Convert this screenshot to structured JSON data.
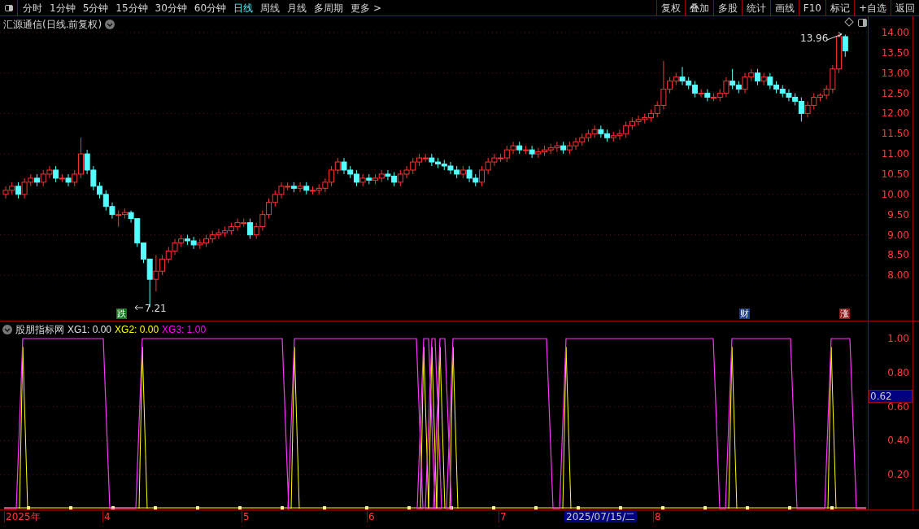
{
  "toolbar": {
    "period_tabs": [
      {
        "label": "分时",
        "selected": false
      },
      {
        "label": "1分钟",
        "selected": false
      },
      {
        "label": "5分钟",
        "selected": false
      },
      {
        "label": "15分钟",
        "selected": false
      },
      {
        "label": "30分钟",
        "selected": false
      },
      {
        "label": "60分钟",
        "selected": false
      },
      {
        "label": "日线",
        "selected": true
      },
      {
        "label": "周线",
        "selected": false
      },
      {
        "label": "月线",
        "selected": false
      },
      {
        "label": "多周期",
        "selected": false
      }
    ],
    "more": "更多 >",
    "actions": [
      "复权",
      "叠加",
      "多股",
      "统计",
      "画线",
      "F10",
      "标记",
      "+自选",
      "返回"
    ]
  },
  "chart_title": "汇源通信(日线.前复权)",
  "chart_data": {
    "type": "candlestick",
    "ohlc": [
      [
        10.0,
        10.2,
        9.9,
        10.1
      ],
      [
        10.1,
        10.3,
        10.0,
        10.2
      ],
      [
        10.2,
        10.3,
        9.9,
        10.0
      ],
      [
        10.0,
        10.4,
        9.9,
        10.3
      ],
      [
        10.3,
        10.5,
        10.2,
        10.4
      ],
      [
        10.4,
        10.5,
        10.2,
        10.3
      ],
      [
        10.3,
        10.6,
        10.2,
        10.5
      ],
      [
        10.5,
        10.7,
        10.4,
        10.6
      ],
      [
        10.6,
        10.7,
        10.3,
        10.4
      ],
      [
        10.4,
        10.5,
        10.3,
        10.4
      ],
      [
        10.4,
        10.5,
        10.2,
        10.3
      ],
      [
        10.3,
        10.6,
        10.2,
        10.5
      ],
      [
        10.5,
        11.4,
        10.4,
        11.0
      ],
      [
        11.0,
        11.1,
        10.5,
        10.6
      ],
      [
        10.6,
        10.7,
        10.1,
        10.2
      ],
      [
        10.2,
        10.3,
        9.9,
        10.0
      ],
      [
        10.0,
        10.1,
        9.6,
        9.7
      ],
      [
        9.7,
        9.8,
        9.4,
        9.5
      ],
      [
        9.5,
        9.6,
        9.2,
        9.5
      ],
      [
        9.5,
        9.65,
        9.4,
        9.55
      ],
      [
        9.55,
        9.6,
        9.3,
        9.4
      ],
      [
        9.4,
        9.4,
        8.7,
        8.8
      ],
      [
        8.8,
        8.8,
        8.3,
        8.4
      ],
      [
        8.4,
        8.4,
        7.21,
        7.9
      ],
      [
        7.9,
        8.5,
        7.6,
        8.1
      ],
      [
        8.1,
        8.5,
        8.0,
        8.4
      ],
      [
        8.4,
        8.7,
        8.3,
        8.6
      ],
      [
        8.6,
        8.9,
        8.5,
        8.8
      ],
      [
        8.8,
        9.0,
        8.7,
        8.9
      ],
      [
        8.9,
        9.0,
        8.75,
        8.85
      ],
      [
        8.85,
        8.95,
        8.65,
        8.75
      ],
      [
        8.75,
        8.9,
        8.65,
        8.8
      ],
      [
        8.8,
        9.0,
        8.7,
        8.9
      ],
      [
        8.9,
        9.1,
        8.8,
        9.0
      ],
      [
        9.0,
        9.15,
        8.9,
        9.05
      ],
      [
        9.05,
        9.2,
        8.95,
        9.1
      ],
      [
        9.1,
        9.3,
        9.0,
        9.2
      ],
      [
        9.2,
        9.4,
        9.1,
        9.3
      ],
      [
        9.3,
        9.4,
        9.2,
        9.3
      ],
      [
        9.3,
        9.4,
        8.9,
        9.0
      ],
      [
        9.0,
        9.3,
        8.9,
        9.2
      ],
      [
        9.2,
        9.6,
        9.1,
        9.5
      ],
      [
        9.5,
        9.9,
        9.4,
        9.8
      ],
      [
        9.8,
        10.1,
        9.7,
        10.0
      ],
      [
        10.0,
        10.3,
        9.9,
        10.2
      ],
      [
        10.2,
        10.3,
        10.1,
        10.2
      ],
      [
        10.2,
        10.3,
        10.05,
        10.15
      ],
      [
        10.15,
        10.3,
        10.05,
        10.2
      ],
      [
        10.2,
        10.3,
        10.0,
        10.1
      ],
      [
        10.1,
        10.2,
        10.0,
        10.1
      ],
      [
        10.1,
        10.25,
        10.0,
        10.15
      ],
      [
        10.15,
        10.4,
        10.05,
        10.3
      ],
      [
        10.3,
        10.7,
        10.2,
        10.6
      ],
      [
        10.6,
        10.9,
        10.5,
        10.8
      ],
      [
        10.8,
        10.9,
        10.5,
        10.6
      ],
      [
        10.6,
        10.7,
        10.4,
        10.5
      ],
      [
        10.5,
        10.6,
        10.2,
        10.3
      ],
      [
        10.3,
        10.5,
        10.2,
        10.4
      ],
      [
        10.4,
        10.5,
        10.25,
        10.35
      ],
      [
        10.35,
        10.5,
        10.25,
        10.4
      ],
      [
        10.4,
        10.6,
        10.3,
        10.5
      ],
      [
        10.5,
        10.6,
        10.35,
        10.45
      ],
      [
        10.45,
        10.55,
        10.2,
        10.3
      ],
      [
        10.3,
        10.6,
        10.2,
        10.5
      ],
      [
        10.5,
        10.7,
        10.4,
        10.6
      ],
      [
        10.6,
        10.9,
        10.5,
        10.8
      ],
      [
        10.8,
        11.0,
        10.7,
        10.9
      ],
      [
        10.9,
        11.0,
        10.8,
        10.9
      ],
      [
        10.9,
        11.0,
        10.7,
        10.8
      ],
      [
        10.8,
        10.9,
        10.65,
        10.75
      ],
      [
        10.75,
        10.85,
        10.6,
        10.7
      ],
      [
        10.7,
        10.8,
        10.5,
        10.6
      ],
      [
        10.6,
        10.7,
        10.4,
        10.5
      ],
      [
        10.5,
        10.7,
        10.4,
        10.6
      ],
      [
        10.6,
        10.7,
        10.3,
        10.4
      ],
      [
        10.4,
        10.5,
        10.2,
        10.3
      ],
      [
        10.3,
        10.7,
        10.2,
        10.6
      ],
      [
        10.6,
        10.9,
        10.5,
        10.8
      ],
      [
        10.8,
        11.0,
        10.7,
        10.9
      ],
      [
        10.9,
        11.0,
        10.8,
        10.9
      ],
      [
        10.9,
        11.2,
        10.8,
        11.1
      ],
      [
        11.1,
        11.3,
        11.0,
        11.2
      ],
      [
        11.2,
        11.3,
        11.0,
        11.1
      ],
      [
        11.1,
        11.2,
        11.0,
        11.1
      ],
      [
        11.1,
        11.2,
        10.9,
        11.0
      ],
      [
        11.0,
        11.15,
        10.9,
        11.05
      ],
      [
        11.05,
        11.2,
        10.95,
        11.1
      ],
      [
        11.1,
        11.25,
        11.0,
        11.15
      ],
      [
        11.15,
        11.3,
        11.05,
        11.2
      ],
      [
        11.2,
        11.3,
        11.0,
        11.1
      ],
      [
        11.1,
        11.3,
        11.0,
        11.2
      ],
      [
        11.2,
        11.4,
        11.1,
        11.3
      ],
      [
        11.3,
        11.5,
        11.2,
        11.4
      ],
      [
        11.4,
        11.6,
        11.3,
        11.5
      ],
      [
        11.5,
        11.7,
        11.4,
        11.6
      ],
      [
        11.6,
        11.7,
        11.4,
        11.5
      ],
      [
        11.5,
        11.6,
        11.3,
        11.4
      ],
      [
        11.4,
        11.55,
        11.3,
        11.45
      ],
      [
        11.45,
        11.6,
        11.35,
        11.5
      ],
      [
        11.5,
        11.8,
        11.4,
        11.7
      ],
      [
        11.7,
        11.9,
        11.6,
        11.8
      ],
      [
        11.8,
        11.95,
        11.7,
        11.85
      ],
      [
        11.85,
        12.0,
        11.75,
        11.9
      ],
      [
        11.9,
        12.1,
        11.8,
        12.0
      ],
      [
        12.0,
        12.3,
        11.9,
        12.2
      ],
      [
        12.2,
        13.3,
        12.1,
        12.6
      ],
      [
        12.6,
        12.9,
        12.5,
        12.8
      ],
      [
        12.8,
        13.0,
        12.7,
        12.9
      ],
      [
        12.9,
        13.15,
        12.7,
        12.8
      ],
      [
        12.8,
        12.9,
        12.6,
        12.7
      ],
      [
        12.7,
        12.8,
        12.4,
        12.5
      ],
      [
        12.5,
        12.6,
        12.4,
        12.5
      ],
      [
        12.5,
        12.6,
        12.3,
        12.4
      ],
      [
        12.4,
        12.5,
        12.3,
        12.4
      ],
      [
        12.4,
        12.6,
        12.3,
        12.5
      ],
      [
        12.5,
        12.9,
        12.4,
        12.8
      ],
      [
        12.8,
        13.1,
        12.6,
        12.7
      ],
      [
        12.7,
        12.8,
        12.5,
        12.6
      ],
      [
        12.6,
        13.0,
        12.5,
        12.9
      ],
      [
        12.9,
        13.1,
        12.8,
        13.0
      ],
      [
        13.0,
        13.1,
        12.7,
        12.8
      ],
      [
        12.8,
        13.0,
        12.7,
        12.9
      ],
      [
        12.9,
        13.0,
        12.6,
        12.7
      ],
      [
        12.7,
        12.8,
        12.5,
        12.6
      ],
      [
        12.6,
        12.7,
        12.4,
        12.5
      ],
      [
        12.5,
        12.6,
        12.3,
        12.4
      ],
      [
        12.4,
        12.5,
        12.2,
        12.3
      ],
      [
        12.3,
        12.4,
        11.8,
        12.0
      ],
      [
        12.0,
        12.3,
        11.9,
        12.2
      ],
      [
        12.2,
        12.5,
        12.1,
        12.4
      ],
      [
        12.4,
        12.5,
        12.3,
        12.45
      ],
      [
        12.45,
        12.7,
        12.35,
        12.6
      ],
      [
        12.6,
        13.2,
        12.5,
        13.1
      ],
      [
        13.1,
        13.96,
        13.0,
        13.9
      ],
      [
        13.9,
        13.95,
        13.4,
        13.55
      ]
    ]
  },
  "price_axis": [
    "14.00",
    "13.50",
    "13.00",
    "12.50",
    "12.00",
    "11.50",
    "11.00",
    "10.50",
    "10.00",
    "9.50",
    "9.00",
    "8.50",
    "8.00"
  ],
  "annotations": {
    "high": "13.96",
    "low": "7.21"
  },
  "markers": [
    {
      "label": "跌",
      "color": "#0f7a1e"
    },
    {
      "label": "财",
      "color": "#1c3a8c"
    },
    {
      "label": "涨",
      "color": "#8c1c1c"
    }
  ],
  "indicator": {
    "name": "股朋指标网",
    "values": [
      {
        "label": "XG1: 0.00",
        "kind": "plain"
      },
      {
        "label": "XG2: 0.00",
        "kind": "signal"
      },
      {
        "label": "XG3: 1.00",
        "kind": "select"
      }
    ],
    "axis": [
      "1.00",
      "0.80",
      "0.60",
      "0.40",
      "0.20"
    ],
    "cursor_value": "0.62"
  },
  "date_axis": [
    "2025年",
    "4",
    "5",
    "6",
    "7",
    "8"
  ],
  "date_cursor": "2025/07/15/二"
}
